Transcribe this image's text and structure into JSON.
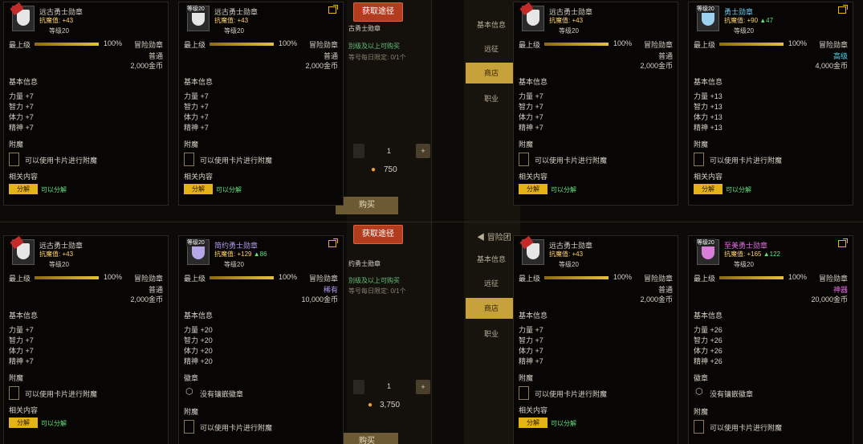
{
  "common": {
    "level_label": "等级20",
    "max_level_label": "最上级",
    "progress_pct": "100%",
    "progress_fraction": 1.0,
    "category": "冒险勋章",
    "basic_info": "基本信息",
    "enchant_section": "附魔",
    "enchant_text": "可以使用卡片进行附魔",
    "related": "相关内容",
    "decompose_button": "分解",
    "decompose_text": "可以分解",
    "emblem_section": "徽章",
    "emblem_text": "没有镶嵌徽章",
    "lv_tag": "等级20",
    "str": "力量",
    "int": "智力",
    "vit": "体力",
    "spi": "精神"
  },
  "background": {
    "get_button": "获取途径",
    "buy_button": "购买",
    "quantity": "1",
    "price_top": "750",
    "price_bottom": "3,750",
    "nav_items": [
      "基本信息",
      "远征",
      "商店",
      "职业"
    ],
    "bg_title_top": "古勇士勋章",
    "bg_title_bottom": "约勇士勋章",
    "bg_note1": "別级及以上可购买",
    "bg_note2": "等号每日限定: 0/1个",
    "adventure": "冒险团",
    "colors": {
      "get_button": "#b33c1f",
      "nav_active": "#c7a13a",
      "decompose": "#e4b317"
    }
  },
  "cards": {
    "ancient": {
      "name": "远古勇士勋章",
      "resist": "抗魔值: +43",
      "resist_up": "",
      "grade": "普通",
      "price": "2,000金币",
      "stats": [
        "+7",
        "+7",
        "+7",
        "+7"
      ],
      "name_color": "#e8e0d0",
      "grade_color": "#d8d2c6"
    },
    "warrior": {
      "name": "勇士勋章",
      "resist": "抗魔值: +90",
      "resist_up": "▲47",
      "grade": "高级",
      "price": "4,000金币",
      "stats": [
        "+13",
        "+13",
        "+13",
        "+13"
      ],
      "name_color": "#6fc8f0",
      "grade_color": "#6fc8f0"
    },
    "moon": {
      "name": "简约勇士勋章",
      "resist": "抗魔值: +129",
      "resist_up": "▲86",
      "grade": "稀有",
      "price": "10,000金币",
      "stats": [
        "+20",
        "+20",
        "+20",
        "+20"
      ],
      "name_color": "#b09cf0",
      "grade_color": "#b09cf0"
    },
    "supreme": {
      "name": "至美勇士勋章",
      "resist": "抗魔值: +165",
      "resist_up": "▲122",
      "grade": "神器",
      "price": "20,000金币",
      "stats": [
        "+26",
        "+26",
        "+26",
        "+26"
      ],
      "name_color": "#e36ce3",
      "grade_color": "#e36ce3"
    }
  }
}
